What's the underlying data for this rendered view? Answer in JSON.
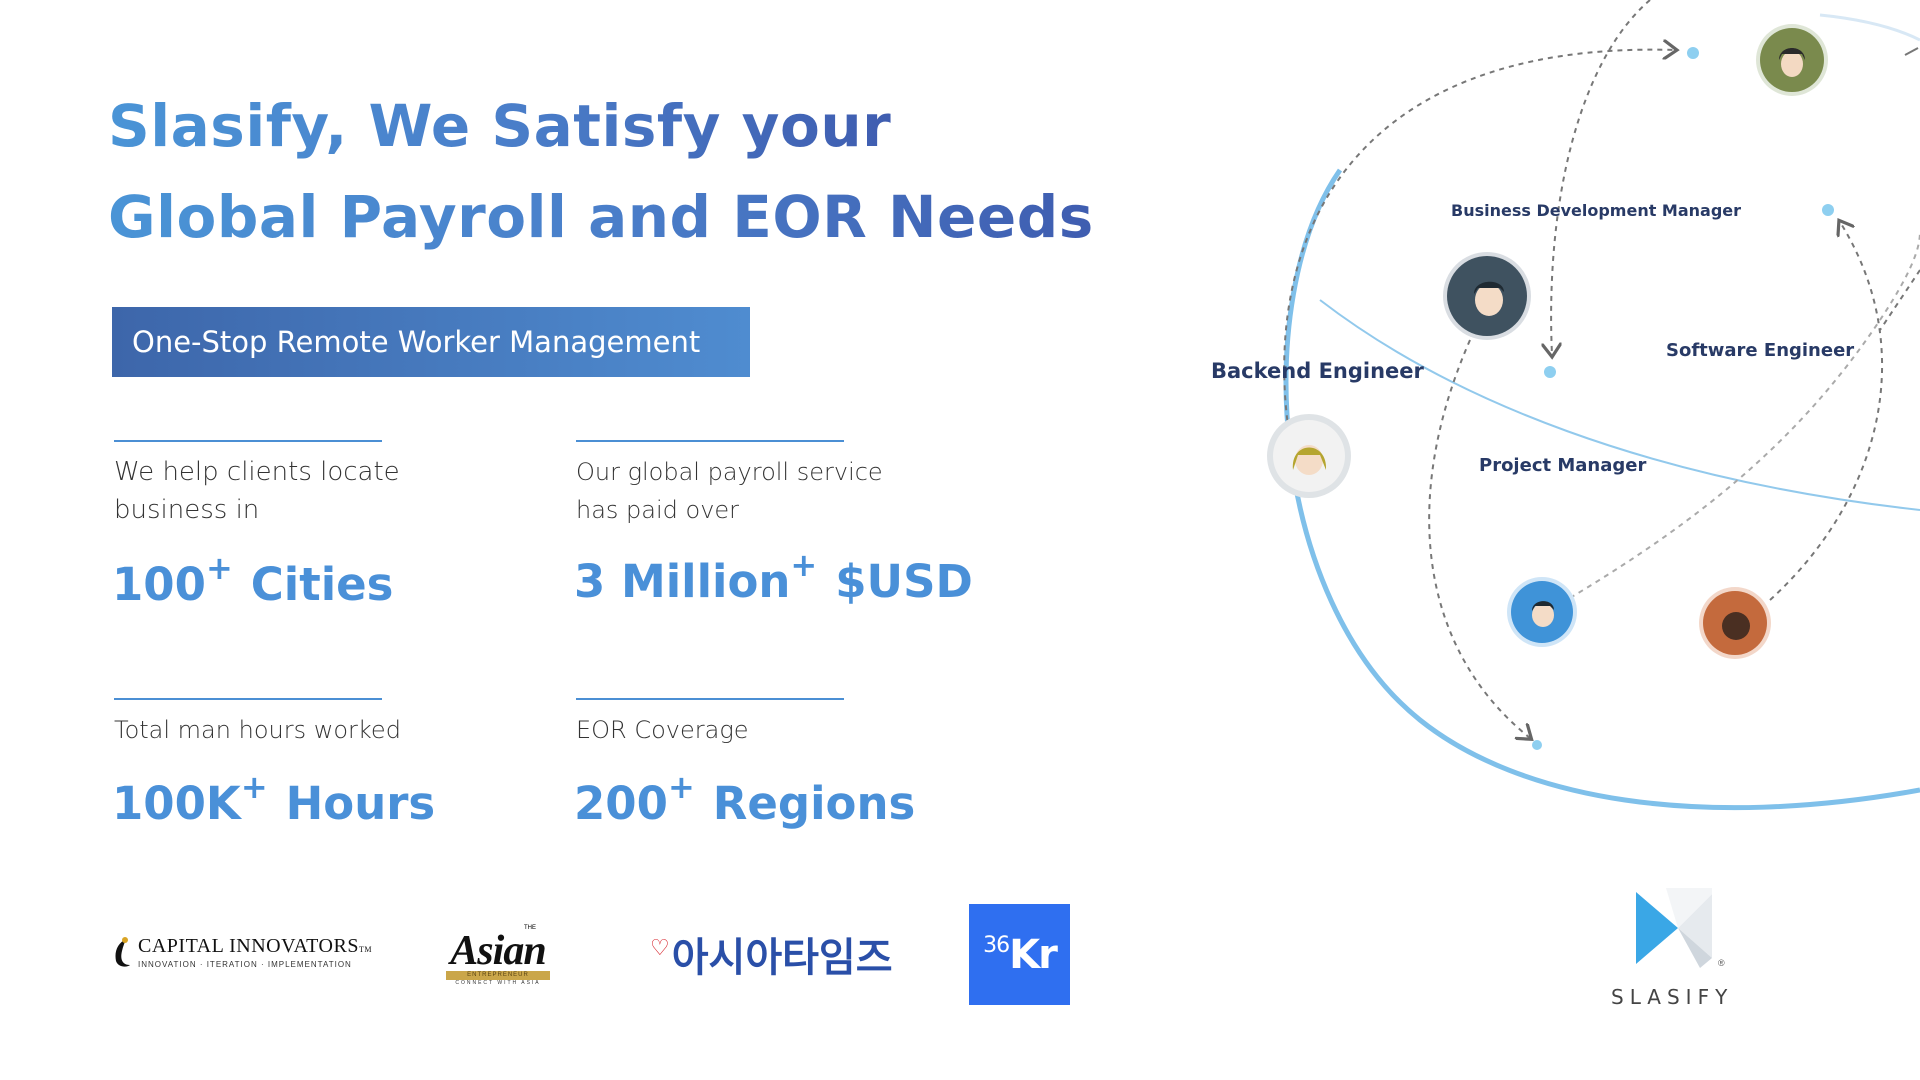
{
  "headline": {
    "line1": "Slasify, We Satisfy your",
    "line2": "Global Payroll and EOR Needs"
  },
  "banner": {
    "label": "One-Stop Remote Worker Management"
  },
  "stats": [
    {
      "desc_line1": "We help clients locate",
      "desc_line2": "business in",
      "value": "100",
      "sup": "+",
      "unit": "Cities"
    },
    {
      "desc_line1": "Our global payroll service",
      "desc_line2": "has paid over",
      "value": "3 Million",
      "sup": "+",
      "unit": "$USD"
    },
    {
      "desc_line1": "Total man hours worked",
      "desc_line2": "",
      "value": "100K",
      "sup": "+",
      "unit": "Hours"
    },
    {
      "desc_line1": "EOR Coverage",
      "desc_line2": "",
      "value": "200",
      "sup": "+",
      "unit": "Regions"
    }
  ],
  "roles": {
    "business_dev": "Business Development Manager",
    "backend": "Backend Engineer",
    "software": "Software Engineer",
    "project": "Project Manager"
  },
  "logos": {
    "capital_innovators": {
      "name": "CAPITAL INNOVATORS",
      "tm": "TM",
      "tagline": "INNOVATION · ITERATION · IMPLEMENTATION"
    },
    "asian": {
      "the": "THE",
      "name": "Asian",
      "bar": "ENTREPRENEUR",
      "tagline": "CONNECT WITH ASIA"
    },
    "korean": {
      "text": "아시아타임즈"
    },
    "kr36": {
      "num": "36",
      "kr": "Kr"
    },
    "slasify": {
      "name": "SLASIFY",
      "reg": "®"
    }
  },
  "colors": {
    "accent": "#4a90d8",
    "navy": "#283a66",
    "banner_start": "#3d66aa",
    "banner_end": "#4f8cd0"
  }
}
